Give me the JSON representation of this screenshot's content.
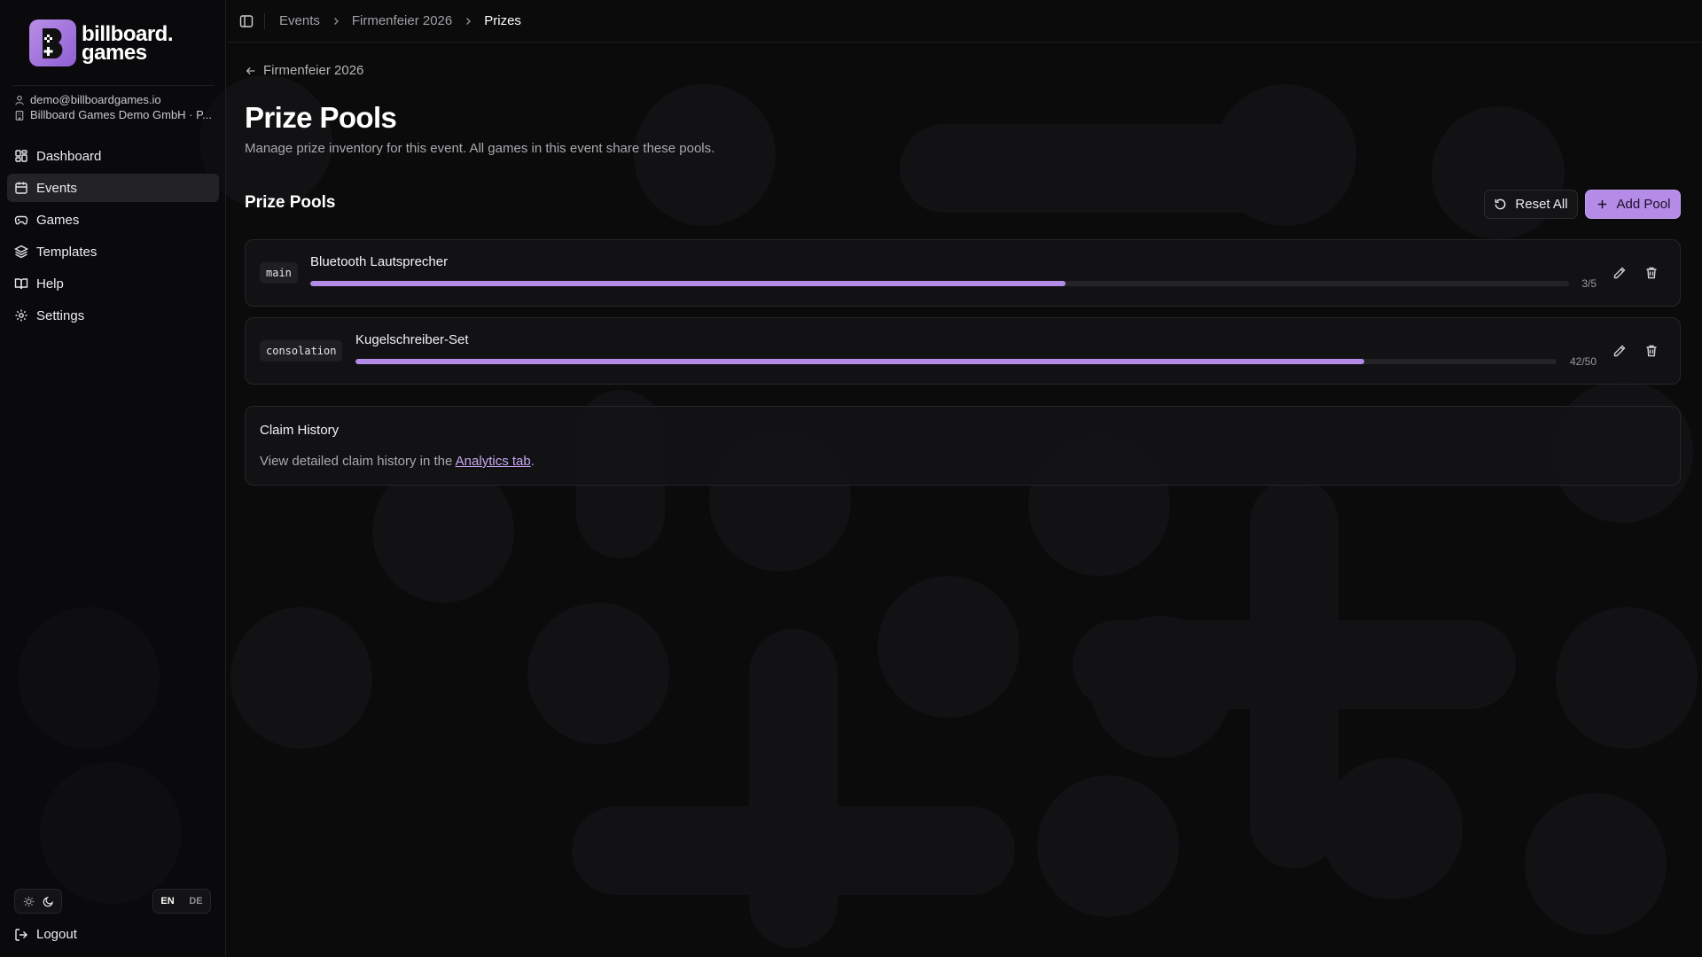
{
  "brand": {
    "line1": "billboard.",
    "line2": "games",
    "accent": "#b48be6"
  },
  "account": {
    "email": "demo@billboardgames.io",
    "org": "Billboard Games Demo GmbH · P..."
  },
  "nav": {
    "items": [
      {
        "label": "Dashboard",
        "icon": "dashboard-icon"
      },
      {
        "label": "Events",
        "icon": "calendar-icon",
        "active": true
      },
      {
        "label": "Games",
        "icon": "gamepad-icon"
      },
      {
        "label": "Templates",
        "icon": "layers-icon"
      },
      {
        "label": "Help",
        "icon": "book-icon"
      },
      {
        "label": "Settings",
        "icon": "gear-icon"
      }
    ]
  },
  "lang": {
    "en": "EN",
    "de": "DE",
    "selected": "EN"
  },
  "logout_label": "Logout",
  "breadcrumb": {
    "items": [
      "Events",
      "Firmenfeier 2026",
      "Prizes"
    ]
  },
  "page": {
    "back_label": "Firmenfeier 2026",
    "title": "Prize Pools",
    "description": "Manage prize inventory for this event. All games in this event share these pools."
  },
  "pools_section": {
    "title": "Prize Pools",
    "reset_label": "Reset All",
    "add_label": "Add Pool"
  },
  "pools": [
    {
      "tag": "main",
      "name": "Bluetooth Lautsprecher",
      "count": "3/5",
      "fraction": 0.6
    },
    {
      "tag": "consolation",
      "name": "Kugelschreiber-Set",
      "count": "42/50",
      "fraction": 0.84
    }
  ],
  "history": {
    "title": "Claim History",
    "text_before": "View detailed claim history in the ",
    "link": "Analytics tab",
    "text_after": "."
  }
}
